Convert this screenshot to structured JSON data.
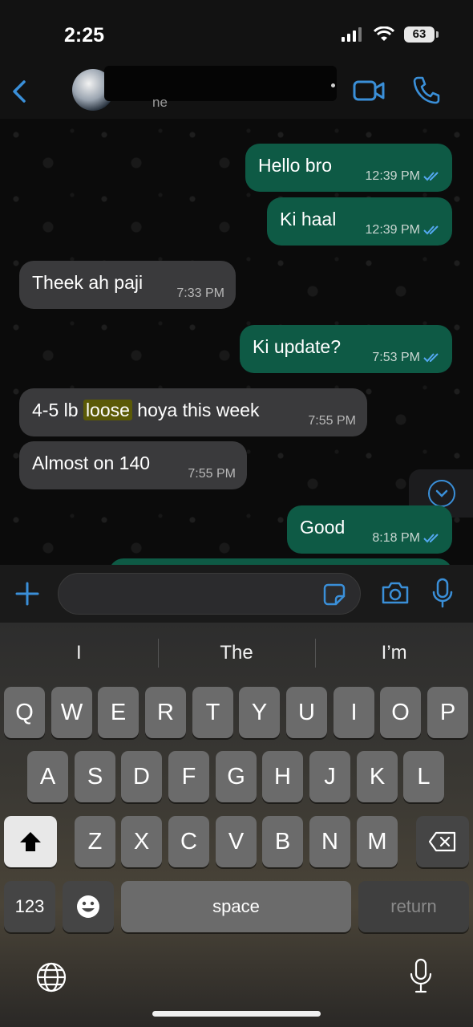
{
  "status": {
    "time": "2:25",
    "battery": "63"
  },
  "header": {
    "name_fragment": "ne"
  },
  "messages": [
    {
      "dir": "out",
      "text": "Hello bro",
      "time": "12:39 PM"
    },
    {
      "dir": "out",
      "text": "Ki haal",
      "time": "12:39 PM"
    },
    {
      "dir": "in",
      "text": "Theek ah paji",
      "time": "7:33 PM"
    },
    {
      "dir": "out",
      "text": "Ki update?",
      "time": "7:53 PM"
    },
    {
      "dir": "in",
      "text_before": "4-5 lb ",
      "highlight": "loose",
      "text_after": " hoya this week",
      "time": "7:55 PM"
    },
    {
      "dir": "in",
      "text": "Almost on 140",
      "time": "7:55 PM"
    },
    {
      "dir": "out",
      "text": "Good",
      "time": "8:18 PM"
    }
  ],
  "colors": {
    "accent": "#3a8fd8",
    "outgoing": "#0e5a45",
    "incoming": "#3a3a3c",
    "highlight": "#5b5a07"
  },
  "keyboard": {
    "suggestions": [
      "I",
      "The",
      "I’m"
    ],
    "row1": [
      "Q",
      "W",
      "E",
      "R",
      "T",
      "Y",
      "U",
      "I",
      "O",
      "P"
    ],
    "row2": [
      "A",
      "S",
      "D",
      "F",
      "G",
      "H",
      "J",
      "K",
      "L"
    ],
    "row3": [
      "Z",
      "X",
      "C",
      "V",
      "B",
      "N",
      "M"
    ],
    "numbers_label": "123",
    "space_label": "space",
    "return_label": "return"
  },
  "icons": [
    "back-chevron-icon",
    "video-call-icon",
    "voice-call-icon",
    "scroll-down-icon",
    "plus-icon",
    "sticker-icon",
    "camera-icon",
    "mic-icon",
    "shift-icon",
    "backspace-icon",
    "emoji-icon",
    "globe-icon",
    "dictation-mic-icon"
  ]
}
